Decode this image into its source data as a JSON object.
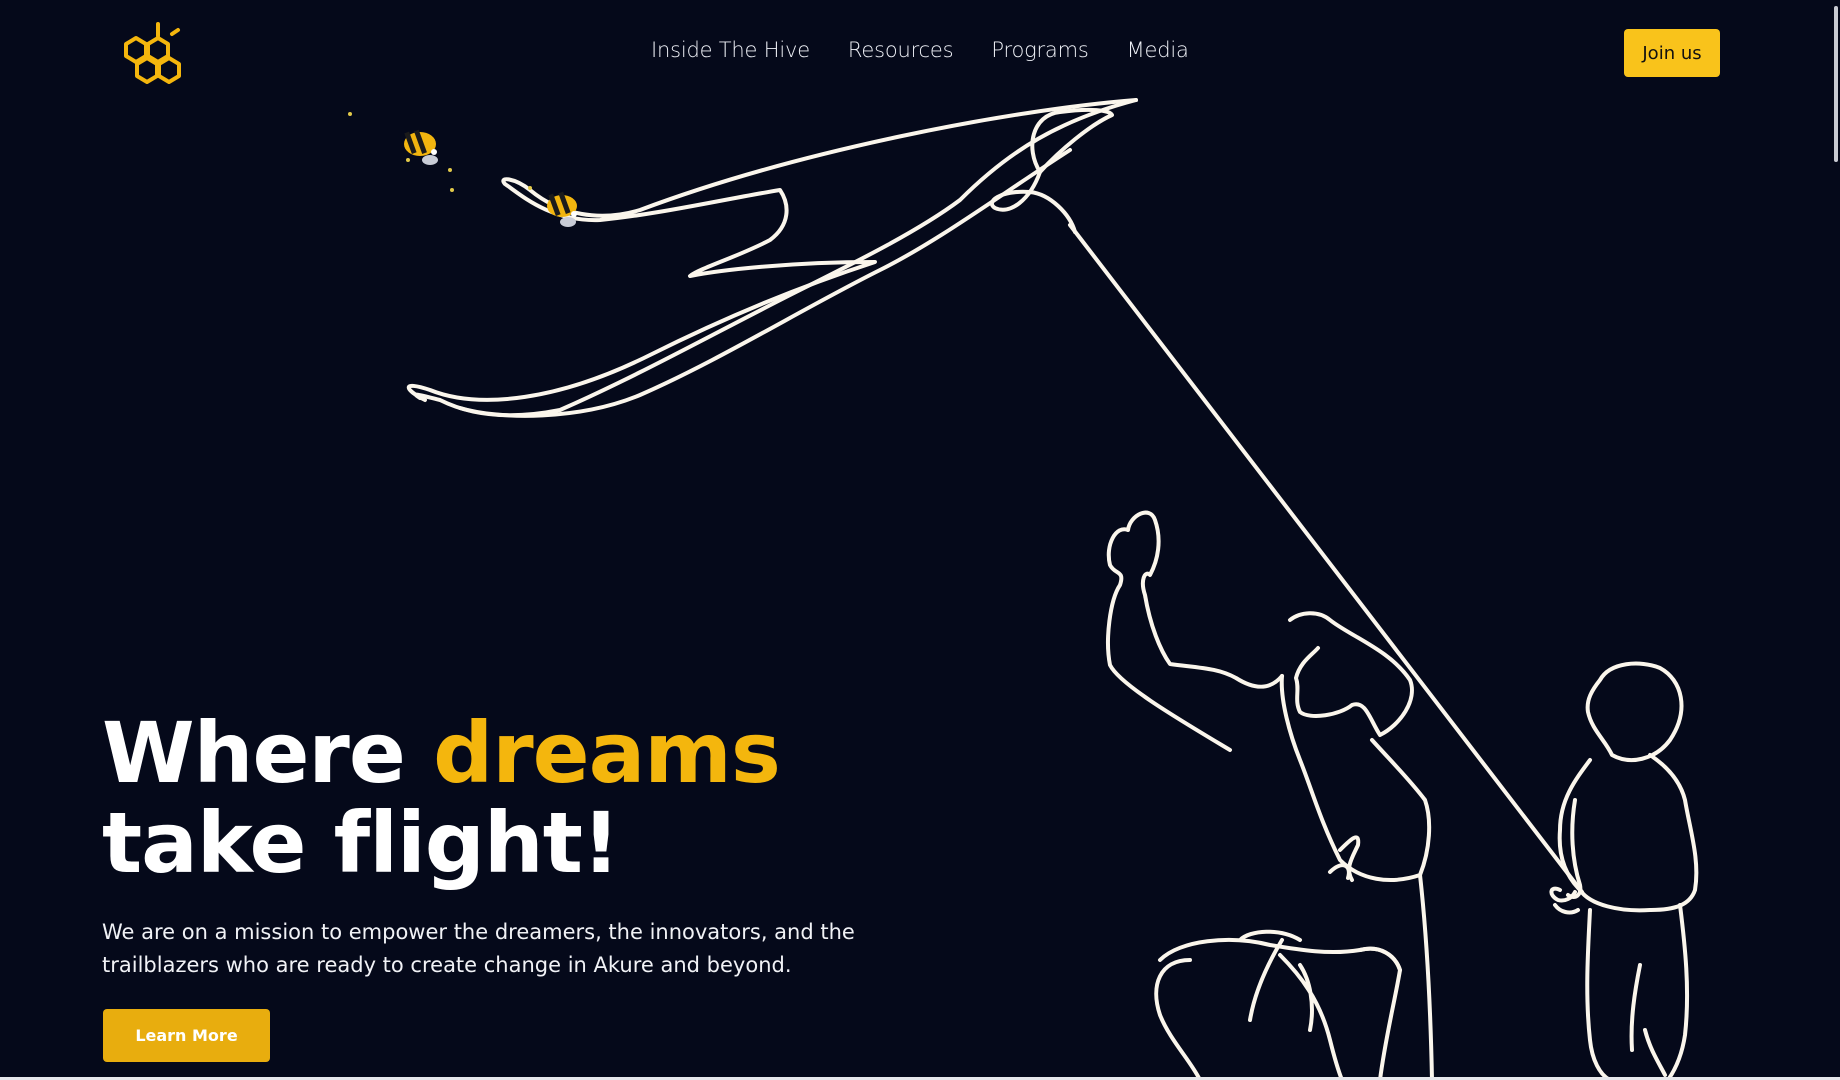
{
  "header": {
    "logo_icon": "honeycomb-bee-logo-icon",
    "nav": [
      {
        "label": "Inside The Hive"
      },
      {
        "label": "Resources"
      },
      {
        "label": "Programs"
      },
      {
        "label": "Media"
      }
    ],
    "join_label": "Join us"
  },
  "hero": {
    "headline_part1": "Where ",
    "headline_accent": "dreams",
    "headline_part2": " take flight!",
    "subtitle": "We are on a mission to empower the dreamers, the innovators, and the trailblazers who are ready to create change in Akure and beyond.",
    "cta_label": "Learn More",
    "illustration": "line-art-kite-fliers-illustration",
    "decorations": [
      "bee-icon",
      "bee-icon"
    ]
  },
  "colors": {
    "background": "#05091a",
    "accent": "#f4b60d",
    "button": "#f9c31b",
    "line_art": "#fbf6ec"
  }
}
